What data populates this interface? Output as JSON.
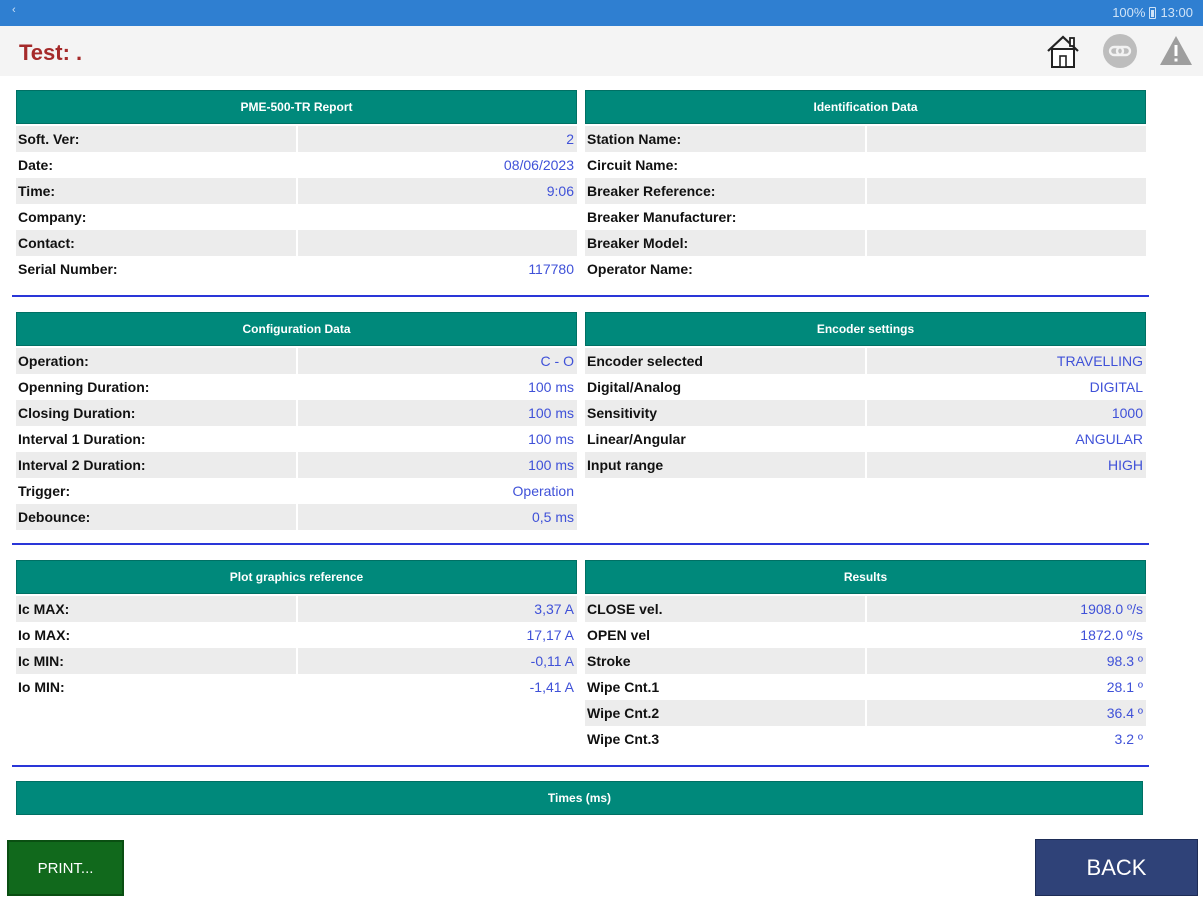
{
  "status_bar": {
    "back_glyph": "‹",
    "battery_text": "100%",
    "time": "13:00"
  },
  "app_bar": {
    "title": "Test: .",
    "home_icon": "home-icon",
    "link_icon": "link-icon",
    "warning_icon": "warning-icon"
  },
  "report": {
    "header": "PME-500-TR Report",
    "rows": [
      {
        "label": "Soft. Ver:",
        "value": "2"
      },
      {
        "label": "Date:",
        "value": "08/06/2023"
      },
      {
        "label": "Time:",
        "value": "9:06"
      },
      {
        "label": "Company:",
        "value": ""
      },
      {
        "label": "Contact:",
        "value": ""
      },
      {
        "label": "Serial Number:",
        "value": "117780"
      }
    ]
  },
  "identification": {
    "header": "Identification Data",
    "rows": [
      {
        "label": "Station Name:",
        "value": ""
      },
      {
        "label": "Circuit Name:",
        "value": ""
      },
      {
        "label": "Breaker Reference:",
        "value": ""
      },
      {
        "label": "Breaker Manufacturer:",
        "value": ""
      },
      {
        "label": "Breaker Model:",
        "value": ""
      },
      {
        "label": "Operator Name:",
        "value": ""
      }
    ]
  },
  "configuration": {
    "header": "Configuration Data",
    "rows": [
      {
        "label": "Operation:",
        "value": "C - O"
      },
      {
        "label": "Openning Duration:",
        "value": "100 ms"
      },
      {
        "label": "Closing Duration:",
        "value": "100 ms"
      },
      {
        "label": "Interval 1 Duration:",
        "value": "100 ms"
      },
      {
        "label": "Interval 2 Duration:",
        "value": "100 ms"
      },
      {
        "label": "Trigger:",
        "value": "Operation"
      },
      {
        "label": "Debounce:",
        "value": "0,5 ms"
      }
    ]
  },
  "encoder": {
    "header": "Encoder settings",
    "rows": [
      {
        "label": "Encoder selected",
        "value": "TRAVELLING"
      },
      {
        "label": "Digital/Analog",
        "value": "DIGITAL"
      },
      {
        "label": "Sensitivity",
        "value": "1000"
      },
      {
        "label": "Linear/Angular",
        "value": "ANGULAR"
      },
      {
        "label": "Input range",
        "value": "HIGH"
      }
    ]
  },
  "plot_reference": {
    "header": "Plot graphics reference",
    "rows": [
      {
        "label": "Ic MAX:",
        "value": "3,37 A"
      },
      {
        "label": "Io MAX:",
        "value": "17,17 A"
      },
      {
        "label": "Ic MIN:",
        "value": "-0,11 A"
      },
      {
        "label": "Io MIN:",
        "value": "-1,41 A"
      }
    ]
  },
  "results": {
    "header": "Results",
    "rows": [
      {
        "label": "CLOSE vel.",
        "value": "1908.0 º/s"
      },
      {
        "label": "OPEN vel",
        "value": "1872.0 º/s"
      },
      {
        "label": "Stroke",
        "value": "98.3 º"
      },
      {
        "label": "Wipe Cnt.1",
        "value": "28.1 º"
      },
      {
        "label": "Wipe Cnt.2",
        "value": "36.4 º"
      },
      {
        "label": "Wipe Cnt.3",
        "value": "3.2 º"
      }
    ]
  },
  "times": {
    "header": "Times (ms)"
  },
  "buttons": {
    "print_label": "PRINT...",
    "back_label": "BACK"
  },
  "colors": {
    "header_teal": "#00897b",
    "value_blue": "#3f51d8",
    "title_red": "#a52a2a",
    "divider_blue": "#2a36d8",
    "print_green": "#11691c",
    "back_navy": "#2f4278"
  }
}
